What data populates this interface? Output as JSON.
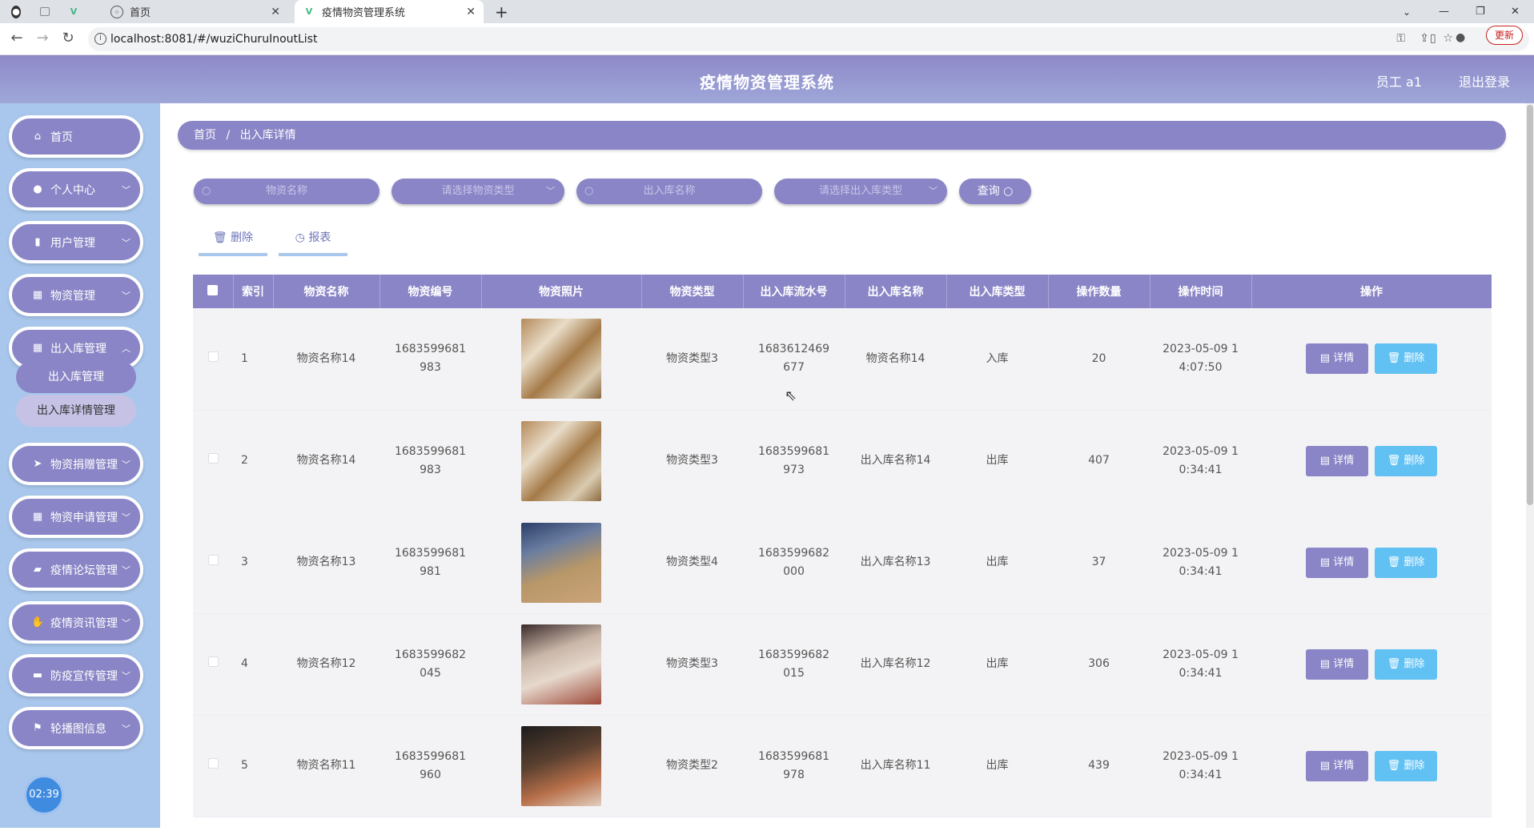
{
  "browser": {
    "tabs": [
      {
        "label": "首页"
      },
      {
        "label": "疫情物资管理系统"
      }
    ],
    "url": "localhost:8081/#/wuziChuruInoutList",
    "update_label": "更新"
  },
  "header": {
    "title": "疫情物资管理系统",
    "user": "员工 a1",
    "logout": "退出登录"
  },
  "sidebar": {
    "items": [
      {
        "label": "首页",
        "icon": "home-icon"
      },
      {
        "label": "个人中心",
        "icon": "user-icon"
      },
      {
        "label": "用户管理",
        "icon": "chart-icon"
      },
      {
        "label": "物资管理",
        "icon": "grid-icon"
      },
      {
        "label": "出入库管理",
        "icon": "grid-icon"
      },
      {
        "label": "物资捐赠管理",
        "icon": "send-icon"
      },
      {
        "label": "物资申请管理",
        "icon": "grid-icon"
      },
      {
        "label": "疫情论坛管理",
        "icon": "book-icon"
      },
      {
        "label": "疫情资讯管理",
        "icon": "thumb-icon"
      },
      {
        "label": "防疫宣传管理",
        "icon": "shop-icon"
      },
      {
        "label": "轮播图信息",
        "icon": "flag-icon"
      }
    ],
    "submenu": [
      "出入库管理",
      "出入库详情管理"
    ],
    "clock": "02:39"
  },
  "breadcrumb": {
    "home": "首页",
    "sep": "/",
    "current": "出入库详情"
  },
  "search": {
    "name_placeholder": "物资名称",
    "type_placeholder": "请选择物资类型",
    "inout_name_placeholder": "出入库名称",
    "inout_type_placeholder": "请选择出入库类型",
    "query_label": "查询"
  },
  "actions": {
    "delete": "删除",
    "report": "报表"
  },
  "table": {
    "headers": [
      "索引",
      "物资名称",
      "物资编号",
      "物资照片",
      "物资类型",
      "出入库流水号",
      "出入库名称",
      "出入库类型",
      "操作数量",
      "操作时间",
      "操作"
    ],
    "detail_label": "详情",
    "delete_label": "删除",
    "rows": [
      {
        "idx": "1",
        "name": "物资名称14",
        "code": "1683599681983",
        "type": "物资类型3",
        "serial": "1683612469677",
        "inout_name": "物资名称14",
        "inout_type": "入库",
        "qty": "20",
        "time": "2023-05-09 14:07:50"
      },
      {
        "idx": "2",
        "name": "物资名称14",
        "code": "1683599681983",
        "type": "物资类型3",
        "serial": "1683599681973",
        "inout_name": "出入库名称14",
        "inout_type": "出库",
        "qty": "407",
        "time": "2023-05-09 10:34:41"
      },
      {
        "idx": "3",
        "name": "物资名称13",
        "code": "1683599681981",
        "type": "物资类型4",
        "serial": "1683599682000",
        "inout_name": "出入库名称13",
        "inout_type": "出库",
        "qty": "37",
        "time": "2023-05-09 10:34:41"
      },
      {
        "idx": "4",
        "name": "物资名称12",
        "code": "1683599682045",
        "type": "物资类型3",
        "serial": "1683599682015",
        "inout_name": "出入库名称12",
        "inout_type": "出库",
        "qty": "306",
        "time": "2023-05-09 10:34:41"
      },
      {
        "idx": "5",
        "name": "物资名称11",
        "code": "1683599681960",
        "type": "物资类型2",
        "serial": "1683599681978",
        "inout_name": "出入库名称11",
        "inout_type": "出库",
        "qty": "439",
        "time": "2023-05-09 10:34:41"
      }
    ]
  }
}
